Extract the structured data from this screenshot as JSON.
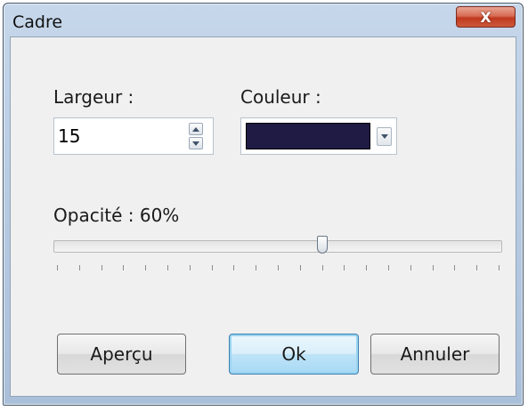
{
  "window": {
    "title": "Cadre",
    "close_label": "X"
  },
  "width_field": {
    "label": "Largeur :",
    "value": "15"
  },
  "color_field": {
    "label": "Couleur :",
    "swatch_color": "#201b44"
  },
  "opacity": {
    "label": "Opacité : 60%",
    "value_percent": 60,
    "tick_count": 21
  },
  "buttons": {
    "preview_label": "Aperçu",
    "ok_label": "Ok",
    "cancel_label": "Annuler"
  }
}
